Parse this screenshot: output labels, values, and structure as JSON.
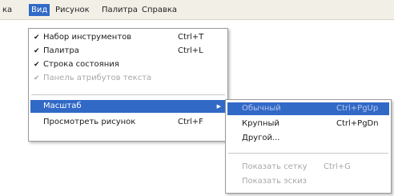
{
  "menubar": {
    "items": [
      {
        "label": "ка"
      },
      {
        "label": "Вид"
      },
      {
        "label": "Рисунок"
      },
      {
        "label": "Палитра"
      },
      {
        "label": "Справка"
      }
    ]
  },
  "view_menu": {
    "items": [
      {
        "label": "Набор инструментов",
        "shortcut": "Ctrl+T",
        "check": "✔"
      },
      {
        "label": "Палитра",
        "shortcut": "Ctrl+L",
        "check": "✔"
      },
      {
        "label": "Строка состояния",
        "shortcut": "",
        "check": "✔"
      },
      {
        "label": "Панель атрибутов текста",
        "shortcut": "",
        "check": "✔"
      },
      {
        "label": "Масштаб",
        "shortcut": "",
        "check": ""
      },
      {
        "label": "Просмотреть рисунок",
        "shortcut": "Ctrl+F",
        "check": ""
      }
    ]
  },
  "zoom_menu": {
    "items": [
      {
        "label": "Обычный",
        "shortcut": "Ctrl+PgUp"
      },
      {
        "label": "Крупный",
        "shortcut": "Ctrl+PgDn"
      },
      {
        "label": "Другой...",
        "shortcut": ""
      },
      {
        "label": "Показать сетку",
        "shortcut": "Ctrl+G"
      },
      {
        "label": "Показать эскиз",
        "shortcut": ""
      }
    ]
  },
  "colors": {
    "highlight": "#3169c6",
    "disabled_text": "#a8a8a8"
  }
}
